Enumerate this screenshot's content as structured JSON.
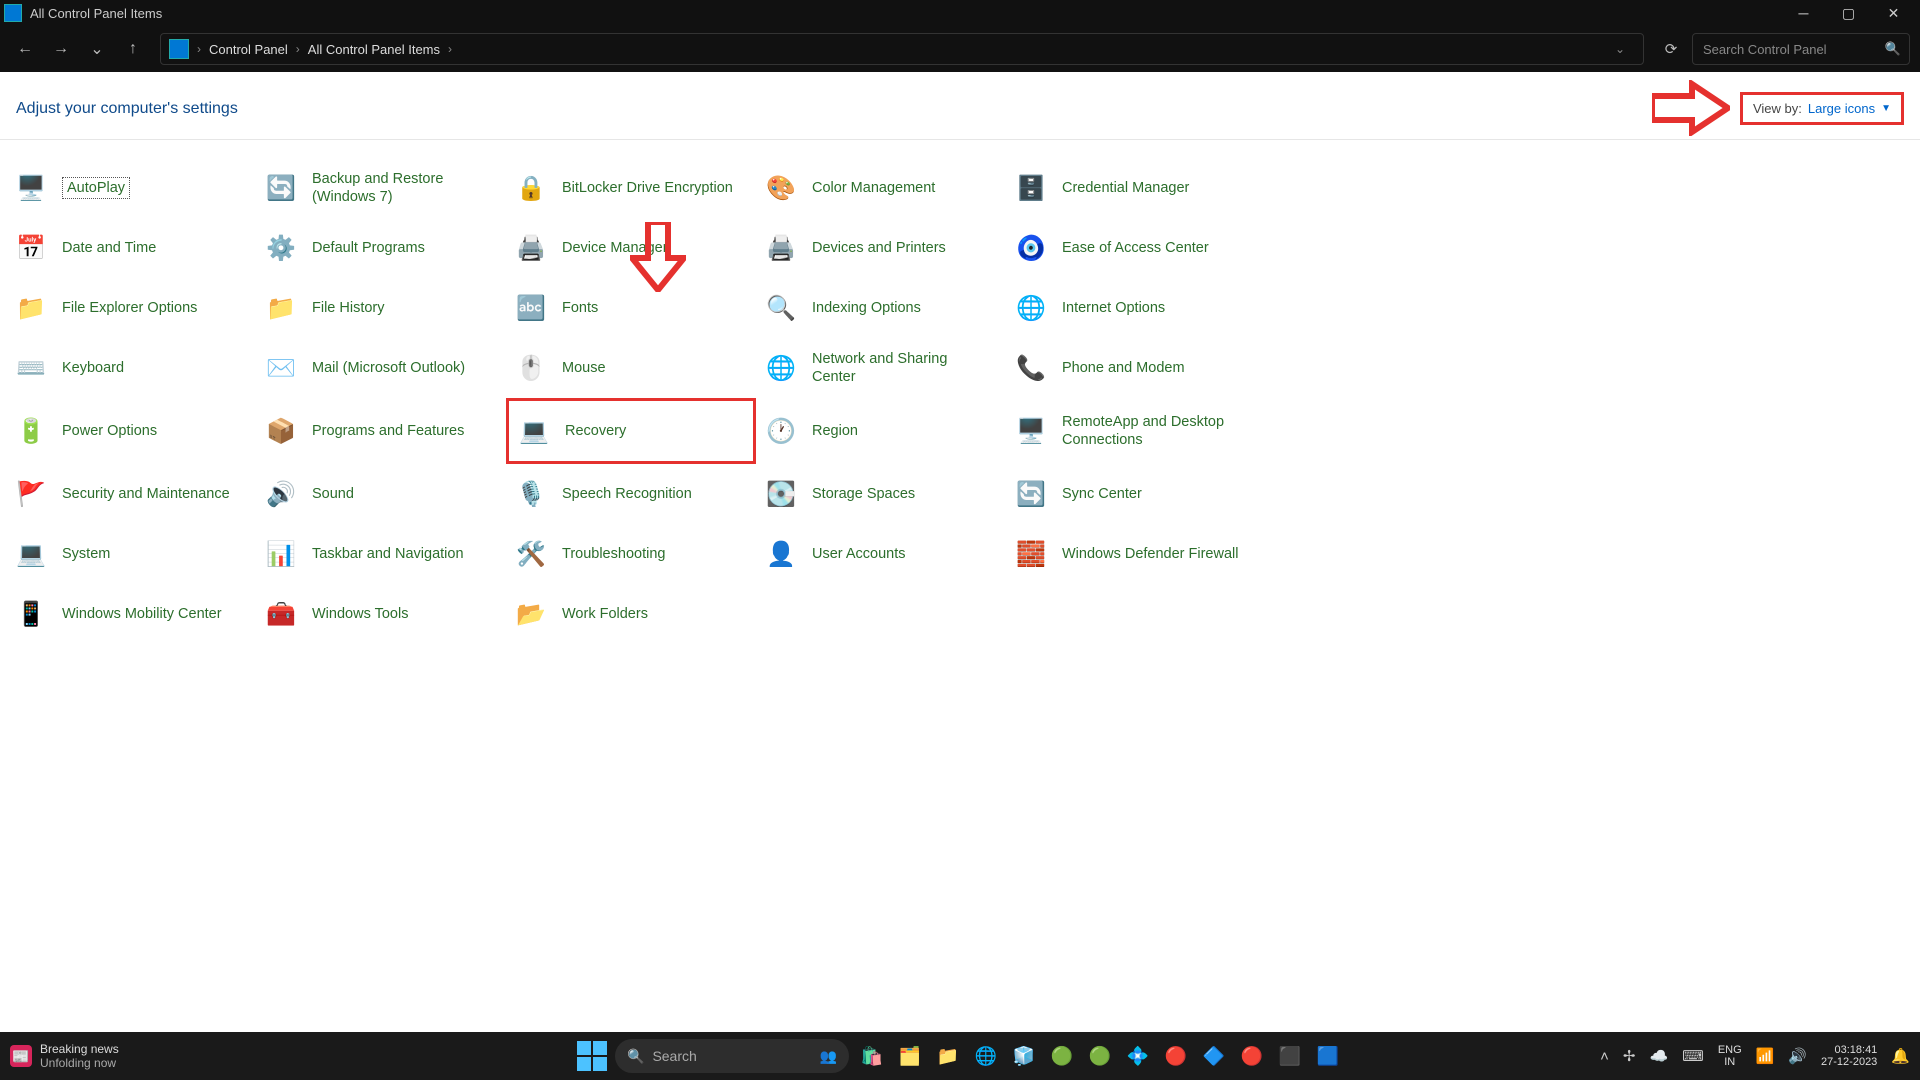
{
  "window": {
    "title": "All Control Panel Items"
  },
  "nav": {
    "breadcrumbs": [
      "Control Panel",
      "All Control Panel Items"
    ],
    "search_placeholder": "Search Control Panel"
  },
  "header": {
    "title": "Adjust your computer's settings",
    "view_by_label": "View by:",
    "view_by_value": "Large icons"
  },
  "items": [
    {
      "label": "AutoPlay",
      "icon": "🖥️"
    },
    {
      "label": "Backup and Restore (Windows 7)",
      "icon": "🔄"
    },
    {
      "label": "BitLocker Drive Encryption",
      "icon": "🔒"
    },
    {
      "label": "Color Management",
      "icon": "🎨"
    },
    {
      "label": "Credential Manager",
      "icon": "🗄️"
    },
    {
      "label": "Date and Time",
      "icon": "📅"
    },
    {
      "label": "Default Programs",
      "icon": "⚙️"
    },
    {
      "label": "Device Manager",
      "icon": "🖨️"
    },
    {
      "label": "Devices and Printers",
      "icon": "🖨️"
    },
    {
      "label": "Ease of Access Center",
      "icon": "🧿"
    },
    {
      "label": "File Explorer Options",
      "icon": "📁"
    },
    {
      "label": "File History",
      "icon": "📁"
    },
    {
      "label": "Fonts",
      "icon": "🔤"
    },
    {
      "label": "Indexing Options",
      "icon": "🔍"
    },
    {
      "label": "Internet Options",
      "icon": "🌐"
    },
    {
      "label": "Keyboard",
      "icon": "⌨️"
    },
    {
      "label": "Mail (Microsoft Outlook)",
      "icon": "✉️"
    },
    {
      "label": "Mouse",
      "icon": "🖱️"
    },
    {
      "label": "Network and Sharing Center",
      "icon": "🌐"
    },
    {
      "label": "Phone and Modem",
      "icon": "📞"
    },
    {
      "label": "Power Options",
      "icon": "🔋"
    },
    {
      "label": "Programs and Features",
      "icon": "📦"
    },
    {
      "label": "Recovery",
      "icon": "💻"
    },
    {
      "label": "Region",
      "icon": "🕐"
    },
    {
      "label": "RemoteApp and Desktop Connections",
      "icon": "🖥️"
    },
    {
      "label": "Security and Maintenance",
      "icon": "🚩"
    },
    {
      "label": "Sound",
      "icon": "🔊"
    },
    {
      "label": "Speech Recognition",
      "icon": "🎙️"
    },
    {
      "label": "Storage Spaces",
      "icon": "💽"
    },
    {
      "label": "Sync Center",
      "icon": "🔄"
    },
    {
      "label": "System",
      "icon": "💻"
    },
    {
      "label": "Taskbar and Navigation",
      "icon": "📊"
    },
    {
      "label": "Troubleshooting",
      "icon": "🛠️"
    },
    {
      "label": "User Accounts",
      "icon": "👤"
    },
    {
      "label": "Windows Defender Firewall",
      "icon": "🧱"
    },
    {
      "label": "Windows Mobility Center",
      "icon": "📱"
    },
    {
      "label": "Windows Tools",
      "icon": "🧰"
    },
    {
      "label": "Work Folders",
      "icon": "📂"
    }
  ],
  "taskbar": {
    "news_title": "Breaking news",
    "news_sub": "Unfolding now",
    "search_placeholder": "Search",
    "lang_top": "ENG",
    "lang_bottom": "IN",
    "time": "03:18:41",
    "date": "27-12-2023"
  }
}
